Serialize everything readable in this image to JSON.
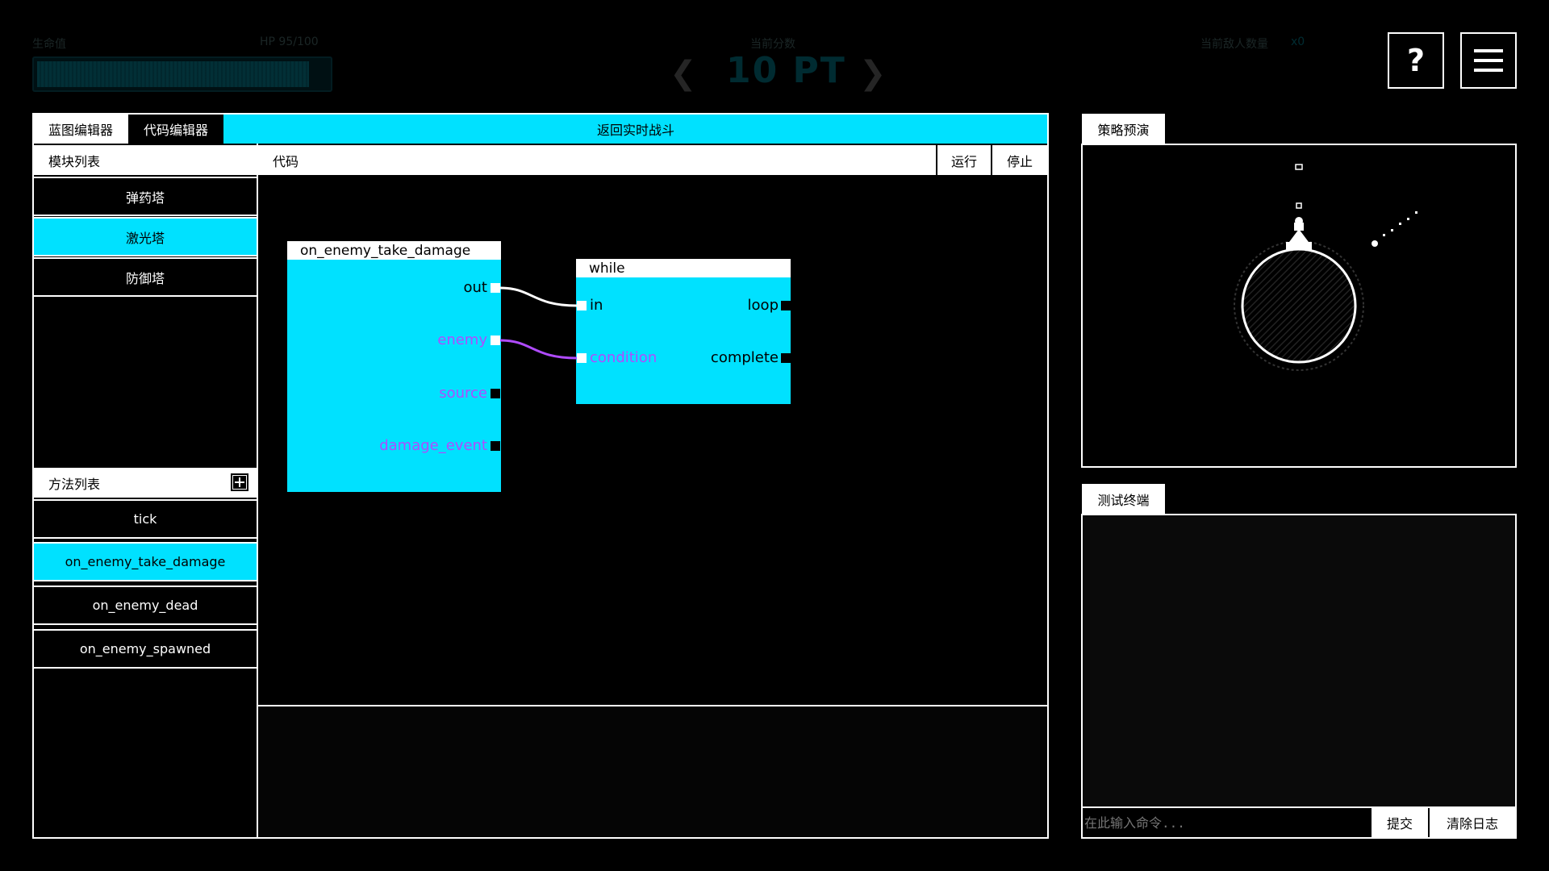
{
  "header": {
    "hp_label": "生命值",
    "hp_value": "HP 95/100",
    "hp_progress": 0.93,
    "points_label": "当前分数",
    "points_value": "10 PT",
    "enemies_label": "当前敌人数量",
    "enemies_value": "x0",
    "help_label": "?",
    "menu_icon": "hamburger-icon"
  },
  "editor_tabs": {
    "blueprint": "蓝图编辑器",
    "code": "代码编辑器",
    "return_battle": "返回实时战斗"
  },
  "module_panel": {
    "title": "模块列表",
    "items": [
      "弹药塔",
      "激光塔",
      "防御塔"
    ],
    "selected_index": 1
  },
  "method_panel": {
    "title": "方法列表",
    "add_icon": "plus-icon",
    "items": [
      "tick",
      "on_enemy_take_damage",
      "on_enemy_dead",
      "on_enemy_spawned"
    ],
    "selected_index": 1
  },
  "code_panel": {
    "title": "代码",
    "run": "运行",
    "stop": "停止"
  },
  "nodes": {
    "event": {
      "title": "on_enemy_take_damage",
      "outputs": [
        "out",
        "enemy",
        "source",
        "damage_event"
      ]
    },
    "while": {
      "title": "while",
      "inputs": [
        "in",
        "condition"
      ],
      "outputs": [
        "loop",
        "complete"
      ]
    }
  },
  "colors": {
    "accent": "#00e1ff",
    "flow_wire": "#ffffff",
    "data_wire": "#b04bff"
  },
  "preview": {
    "title": "策略预演"
  },
  "terminal": {
    "title": "测试终端",
    "placeholder": "在此输入命令...",
    "submit": "提交",
    "clear": "清除日志"
  }
}
